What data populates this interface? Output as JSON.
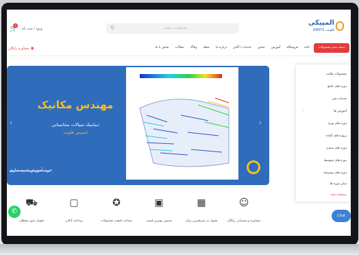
{
  "header": {
    "logo_main": "المپیکی",
    "logo_sub": "ANSYS فلونت",
    "search_placeholder": "جستجو در سایت ...",
    "login_label": "ورود / ثبت نام",
    "cart_count": "0"
  },
  "nav": {
    "category_button": "دسته بندی محصولات",
    "items": [
      "خانه",
      "فروشگاه",
      "آموزش",
      "تماس",
      "خدمات / آنالیز",
      "درباره ما",
      "مجله",
      "وبلاگ",
      "مقالات",
      "تماس با ما"
    ],
    "consult_label": "مشاوره رایگان"
  },
  "hero": {
    "title": "مهندس مکانیک",
    "subtitle": "دینامیک سیالات محاسباتی",
    "brand": "انسیس فلونت",
    "cta": "خرید آموزش شبیه سازی"
  },
  "dropdown": {
    "items": [
      "محصولات فلانت",
      "دوره های جامع",
      "خدمات فنی",
      "آموزش ها",
      "دوره های ویژه",
      "پروژه های آماده",
      "دوره های مبتدی",
      "دوره های متوسط",
      "دوره های پیشرفته",
      "سایر دوره ها"
    ],
    "more_label": "مشاهده همه"
  },
  "features": [
    {
      "label": "مشاوره و پشتیبانی رایگان",
      "icon": "support-icon"
    },
    {
      "label": "تحویل در سریعترین زمان",
      "icon": "map-icon"
    },
    {
      "label": "تضمین بهترین قیمت",
      "icon": "money-icon"
    },
    {
      "label": "ضمانت کیفیت محصولات",
      "icon": "medal-icon"
    },
    {
      "label": "پرداخت آنلاین",
      "icon": "wallet-icon"
    },
    {
      "label": "تحویل بدون معطلی",
      "icon": "truck-icon"
    }
  ],
  "chat_label": "Chat"
}
